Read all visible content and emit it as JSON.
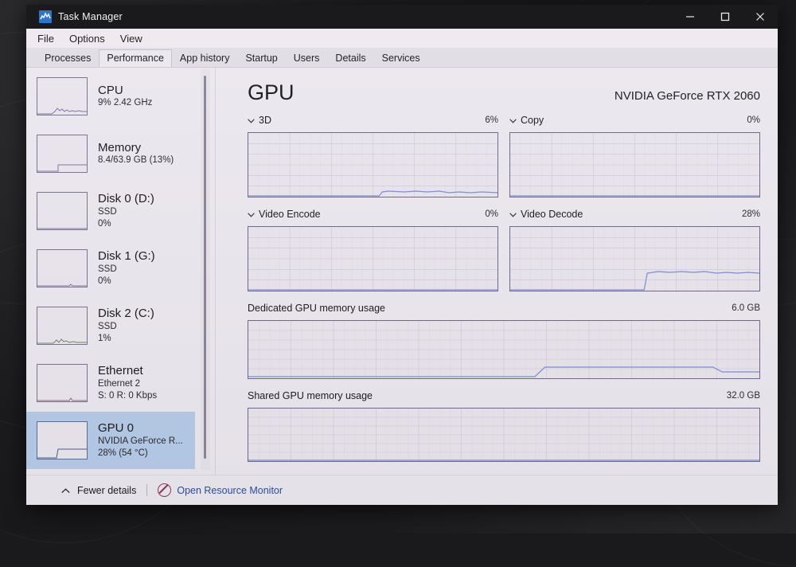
{
  "window": {
    "title": "Task Manager",
    "icon": "task-manager-icon",
    "controls": {
      "minimize": "–",
      "maximize": "□",
      "close": "✕"
    }
  },
  "menu": {
    "items": [
      "File",
      "Options",
      "View"
    ]
  },
  "tabs": {
    "items": [
      {
        "label": "Processes",
        "active": false
      },
      {
        "label": "Performance",
        "active": true
      },
      {
        "label": "App history",
        "active": false
      },
      {
        "label": "Startup",
        "active": false
      },
      {
        "label": "Users",
        "active": false
      },
      {
        "label": "Details",
        "active": false
      },
      {
        "label": "Services",
        "active": false
      }
    ]
  },
  "sidebar": {
    "items": [
      {
        "name": "CPU",
        "line1": "9% 2.42 GHz",
        "line2": "",
        "selected": false
      },
      {
        "name": "Memory",
        "line1": "8.4/63.9 GB (13%)",
        "line2": "",
        "selected": false
      },
      {
        "name": "Disk 0 (D:)",
        "line1": "SSD",
        "line2": "0%",
        "selected": false
      },
      {
        "name": "Disk 1 (G:)",
        "line1": "SSD",
        "line2": "0%",
        "selected": false
      },
      {
        "name": "Disk 2 (C:)",
        "line1": "SSD",
        "line2": "1%",
        "selected": false
      },
      {
        "name": "Ethernet",
        "line1": "Ethernet 2",
        "line2": "S: 0 R: 0 Kbps",
        "selected": false
      },
      {
        "name": "GPU 0",
        "line1": "NVIDIA GeForce R...",
        "line2": "28% (54 °C)",
        "selected": true
      }
    ]
  },
  "main": {
    "title": "GPU",
    "device": "NVIDIA GeForce RTX 2060",
    "engines": [
      {
        "label": "3D",
        "value": "6%"
      },
      {
        "label": "Copy",
        "value": "0%"
      },
      {
        "label": "Video Encode",
        "value": "0%"
      },
      {
        "label": "Video Decode",
        "value": "28%"
      }
    ],
    "memory": [
      {
        "label": "Dedicated GPU memory usage",
        "max": "6.0 GB"
      },
      {
        "label": "Shared GPU memory usage",
        "max": "32.0 GB"
      }
    ]
  },
  "footer": {
    "fewer_details": "Fewer details",
    "resource_monitor": "Open Resource Monitor"
  },
  "colors": {
    "accent_line": "#7b8fd4",
    "selection": "#b6cbe8",
    "link": "#2b4fa0",
    "window_bg": "#ece8ef",
    "titlebar_bg": "#131316"
  },
  "chart_data": [
    {
      "type": "line",
      "title": "3D",
      "ylabel": "percent",
      "ylim": [
        0,
        100
      ],
      "current": 6,
      "x": [
        0,
        5,
        10,
        15,
        20,
        25,
        30,
        35,
        40,
        45,
        50,
        55,
        60,
        62,
        65,
        70,
        75,
        80,
        85,
        90,
        95,
        100
      ],
      "values": [
        0,
        0,
        0,
        0,
        0,
        0,
        0,
        0,
        0,
        0,
        0,
        0,
        0,
        5,
        6,
        5,
        6,
        6,
        5,
        6,
        6,
        6
      ]
    },
    {
      "type": "line",
      "title": "Copy",
      "ylabel": "percent",
      "ylim": [
        0,
        100
      ],
      "current": 0,
      "x": [
        0,
        20,
        40,
        60,
        80,
        100
      ],
      "values": [
        0,
        0,
        0,
        0,
        0,
        0
      ]
    },
    {
      "type": "line",
      "title": "Video Encode",
      "ylabel": "percent",
      "ylim": [
        0,
        100
      ],
      "current": 0,
      "x": [
        0,
        20,
        40,
        60,
        80,
        100
      ],
      "values": [
        0,
        0,
        0,
        0,
        0,
        0
      ]
    },
    {
      "type": "line",
      "title": "Video Decode",
      "ylabel": "percent",
      "ylim": [
        0,
        100
      ],
      "current": 28,
      "x": [
        0,
        10,
        20,
        30,
        40,
        50,
        54,
        56,
        60,
        65,
        70,
        75,
        80,
        85,
        90,
        95,
        100
      ],
      "values": [
        0,
        0,
        0,
        0,
        0,
        0,
        0,
        28,
        29,
        28,
        29,
        28,
        28,
        27,
        28,
        28,
        27
      ]
    },
    {
      "type": "line",
      "title": "Dedicated GPU memory usage",
      "ylabel": "GB",
      "ylim": [
        0,
        6.0
      ],
      "max_label": "6.0 GB",
      "x": [
        0,
        10,
        20,
        30,
        40,
        50,
        55,
        58,
        62,
        70,
        80,
        88,
        92,
        100
      ],
      "values": [
        0.1,
        0.1,
        0.1,
        0.1,
        0.1,
        0.1,
        0.1,
        1.0,
        1.05,
        1.05,
        1.05,
        1.05,
        0.55,
        0.55
      ]
    },
    {
      "type": "line",
      "title": "Shared GPU memory usage",
      "ylabel": "GB",
      "ylim": [
        0,
        32.0
      ],
      "max_label": "32.0 GB",
      "x": [
        0,
        20,
        40,
        60,
        80,
        100
      ],
      "values": [
        0,
        0,
        0,
        0,
        0,
        0
      ]
    }
  ]
}
